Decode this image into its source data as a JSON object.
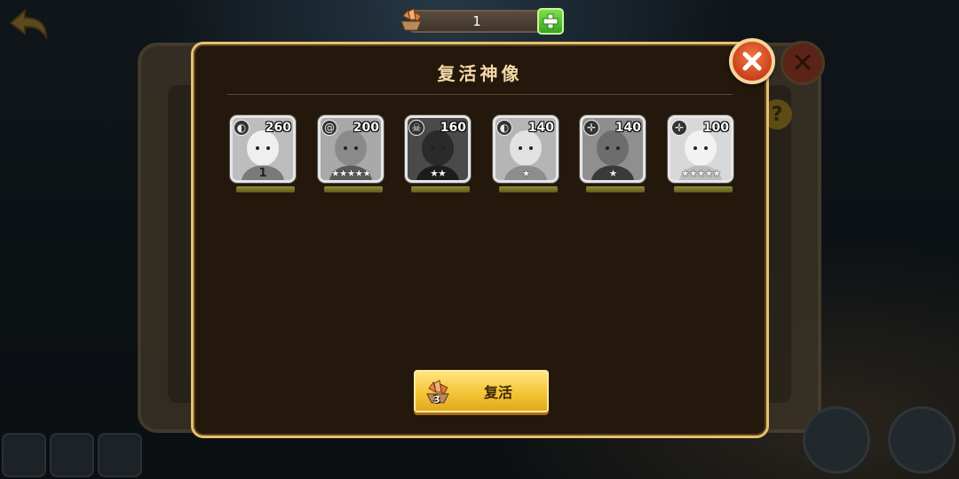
{
  "currency": {
    "amount": "1",
    "icon": "crystal-shard-icon"
  },
  "dialog": {
    "title": "复活神像",
    "close_icon": "close-x-icon"
  },
  "heroes": [
    {
      "element": "water",
      "element_glyph": "◐",
      "level": "260",
      "stars": "",
      "tier": "1"
    },
    {
      "element": "wind",
      "element_glyph": "@",
      "level": "200",
      "stars": "★★★★★",
      "tier": ""
    },
    {
      "element": "dark",
      "element_glyph": "☠",
      "level": "160",
      "stars": "★★",
      "tier": ""
    },
    {
      "element": "water",
      "element_glyph": "◐",
      "level": "140",
      "stars": "★",
      "tier": ""
    },
    {
      "element": "light",
      "element_glyph": "✛",
      "level": "140",
      "stars": "★",
      "tier": ""
    },
    {
      "element": "light",
      "element_glyph": "✛",
      "level": "100",
      "stars": "★★★★★",
      "tier": ""
    }
  ],
  "revive": {
    "label": "复活",
    "cost": "3",
    "icon": "crystal-shard-icon"
  },
  "colors": {
    "dialog_border": "#e8c06c",
    "dialog_bg": "#24170c",
    "button_gold": "#f4c537",
    "close_red": "#e0542a",
    "plus_green": "#4fc02c"
  }
}
